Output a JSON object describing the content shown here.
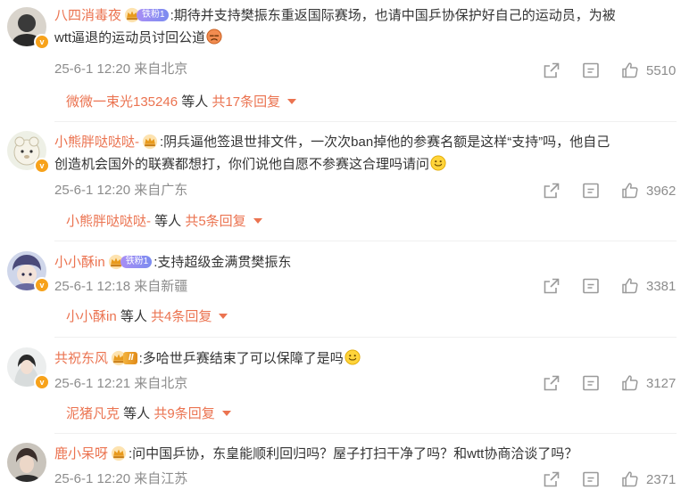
{
  "comments": [
    {
      "username": "八四消毒夜",
      "badge": "铁粉1",
      "text": ":期待并支持樊振东重返国际赛场，也请中国乒协保护好自己的运动员，为被",
      "text2": "wtt逼退的运动员讨回公道",
      "meta": "25-6-1 12:20 来自北京",
      "likes": "5510",
      "reply_user": "微微一束光135246",
      "reply_mid": " 等人 ",
      "reply_count": "共17条回复"
    },
    {
      "username": "小熊胖哒哒哒-",
      "text": ":阴兵逼他签退世排文件，一次次ban掉他的参赛名额是这样“支持”吗，他自己",
      "text2": "创造机会国外的联赛都想打，你们说他自愿不参赛这合理吗请问",
      "meta": "25-6-1 12:20 来自广东",
      "likes": "3962",
      "reply_user": "小熊胖哒哒哒-",
      "reply_mid": " 等人 ",
      "reply_count": "共5条回复"
    },
    {
      "username": "小小酥in",
      "badge": "铁粉1",
      "text": ":支持超级金满贯樊振东",
      "meta": "25-6-1 12:18 来自新疆",
      "likes": "3381",
      "reply_user": "小小酥in",
      "reply_mid": " 等人 ",
      "reply_count": "共4条回复"
    },
    {
      "username": "共祝东风",
      "badge": "II",
      "text": ":多哈世乒赛结束了可以保障了是吗",
      "meta": "25-6-1 12:21 来自北京",
      "likes": "3127",
      "reply_user": "泥猪凡克",
      "reply_mid": " 等人 ",
      "reply_count": "共9条回复"
    },
    {
      "username": "鹿小呆呀",
      "text": ":问中国乒协，东皇能顺利回归吗？屋子打扫干净了吗？和wtt协商洽谈了吗？",
      "meta": "25-6-1 12:20 来自江苏",
      "likes": "2371"
    }
  ],
  "icons": {
    "share": "share-icon",
    "comment": "comment-icon",
    "like": "thumbs-up-icon",
    "crown": "crown-icon",
    "emoji": "smile-emoji-icon"
  },
  "colors": {
    "username": "#eb7350",
    "meta": "#8c8c8c",
    "text": "#333333"
  }
}
